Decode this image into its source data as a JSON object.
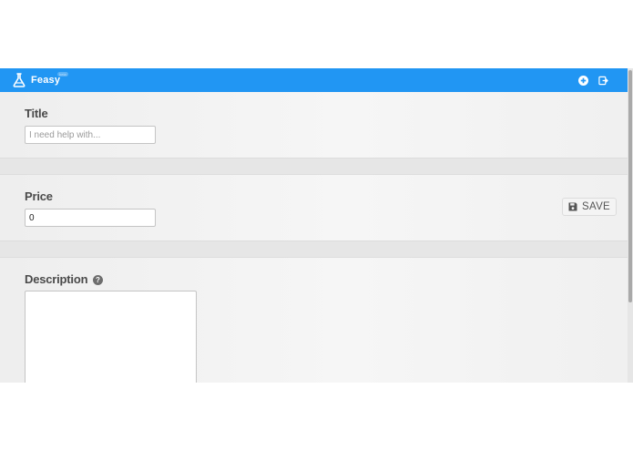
{
  "navbar": {
    "brand_name": "Feasy",
    "beta_badge": "beta",
    "icons": [
      "flask-icon",
      "add-circle-icon",
      "sign-out-icon"
    ],
    "color": "#2196f3"
  },
  "form": {
    "title_label": "Title",
    "title_placeholder": "I need help with...",
    "title_value": "",
    "price_label": "Price",
    "price_value": "0",
    "description_label": "Description",
    "description_help_icon": "?",
    "description_value": ""
  },
  "actions": {
    "save_label": "SAVE",
    "save_icon": "floppy-disk-icon"
  }
}
